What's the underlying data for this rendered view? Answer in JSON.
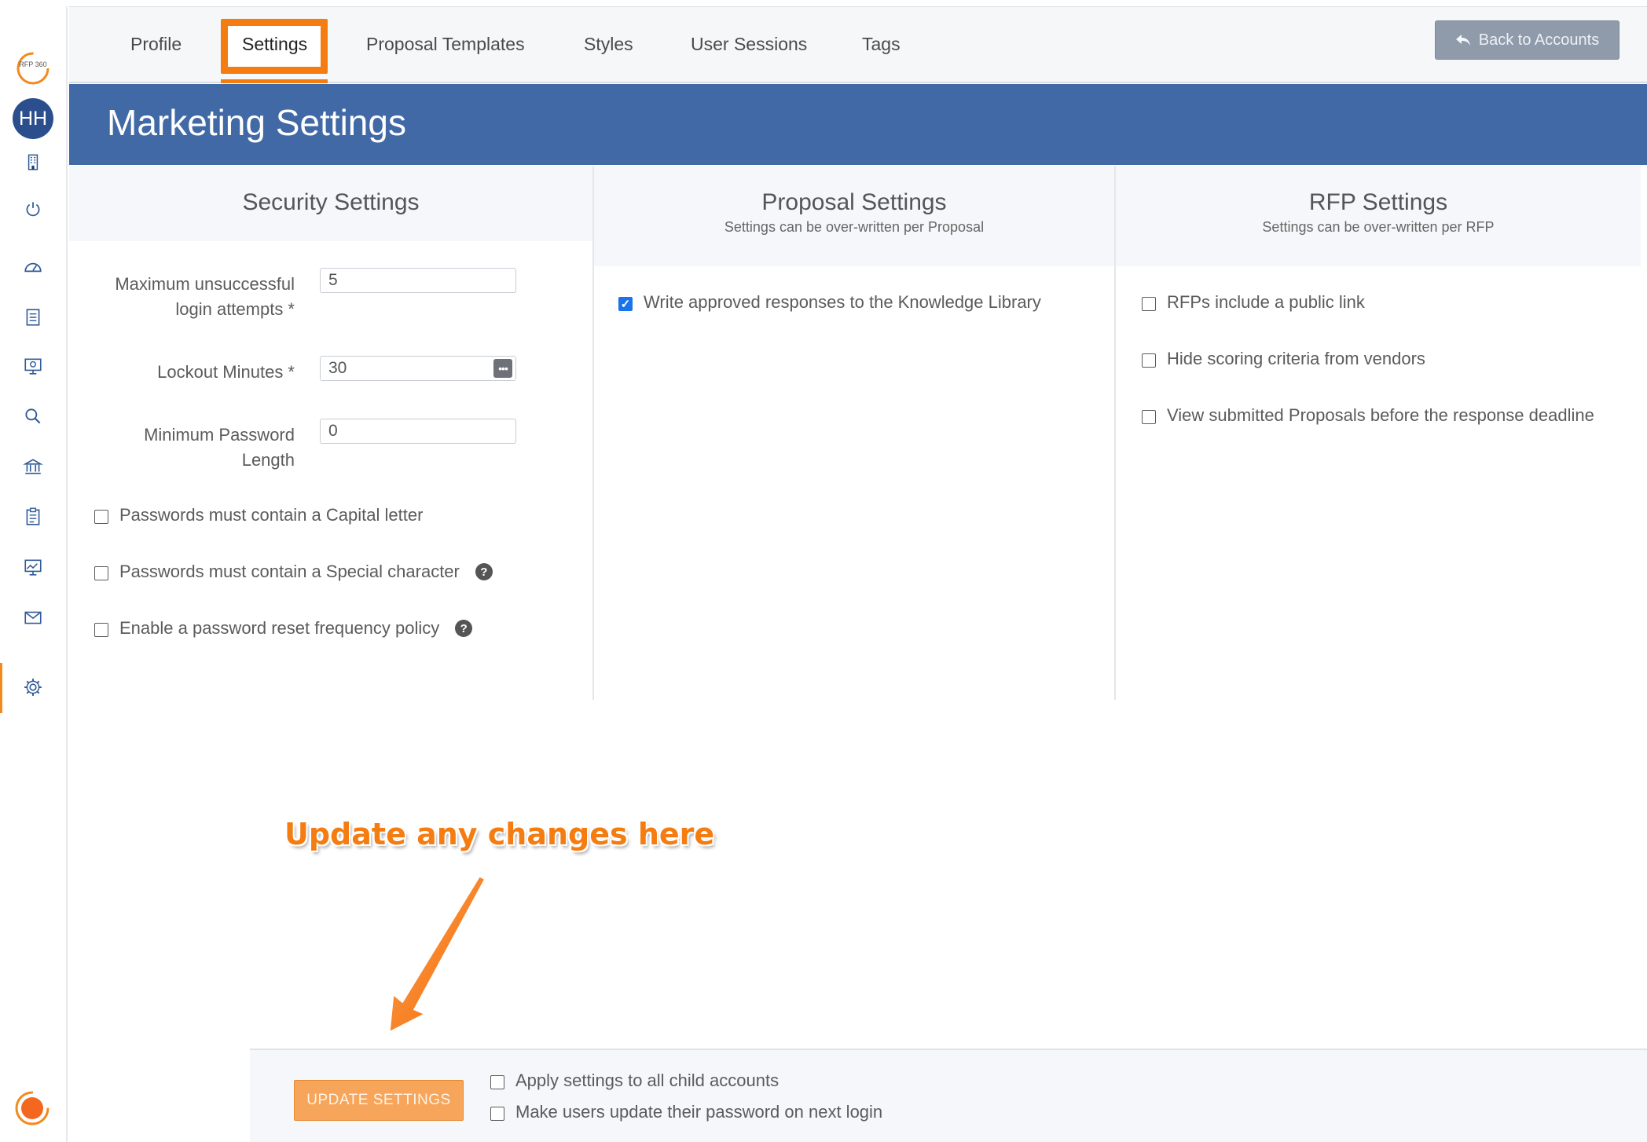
{
  "tabs": [
    {
      "label": "Profile"
    },
    {
      "label": "Settings",
      "active": true
    },
    {
      "label": "Proposal Templates"
    },
    {
      "label": "Styles"
    },
    {
      "label": "User Sessions"
    },
    {
      "label": "Tags"
    }
  ],
  "back_button": {
    "label": "Back to Accounts",
    "icon": "reply-arrow-icon"
  },
  "sidebar": {
    "logo_text": "RFP 360",
    "avatar_initials": "HH",
    "icons": [
      "building-icon",
      "power-icon",
      "dashboard-gauge-icon",
      "document-icon",
      "monitor-icon",
      "search-icon",
      "bank-icon",
      "clipboard-icon",
      "chart-monitor-icon",
      "mail-icon",
      "gear-icon"
    ],
    "active": "gear-icon"
  },
  "page_title": "Marketing Settings",
  "security": {
    "title": "Security Settings",
    "max_attempts_label_1": "Maximum unsuccessful",
    "max_attempts_label_2": "login attempts  *",
    "max_attempts_value": "5",
    "lockout_label": "Lockout Minutes  *",
    "lockout_value": "30",
    "min_pw_label_1": "Minimum Password",
    "min_pw_label_2": "Length",
    "min_pw_value": "0",
    "cb_capital": "Passwords must contain a Capital letter",
    "cb_special": "Passwords must contain a Special character",
    "cb_reset": "Enable a password reset frequency policy"
  },
  "proposal": {
    "title": "Proposal Settings",
    "subtitle": "Settings can be over-written per Proposal",
    "cb_write": "Write approved responses to the Knowledge Library"
  },
  "rfp": {
    "title": "RFP Settings",
    "subtitle": "Settings can be over-written per RFP",
    "cb_public": "RFPs include a public link",
    "cb_hide": "Hide scoring criteria from vendors",
    "cb_view": "View submitted Proposals before the response deadline"
  },
  "annotation": "Update any changes here",
  "footer": {
    "update_label": "UPDATE SETTINGS",
    "cb_apply": "Apply settings to all child accounts",
    "cb_force": "Make users update their password on next login"
  },
  "colors": {
    "accent": "#f57c10",
    "banner": "#4169a6",
    "avatar": "#2b4f8c",
    "checkbox": "#1a73e8"
  }
}
